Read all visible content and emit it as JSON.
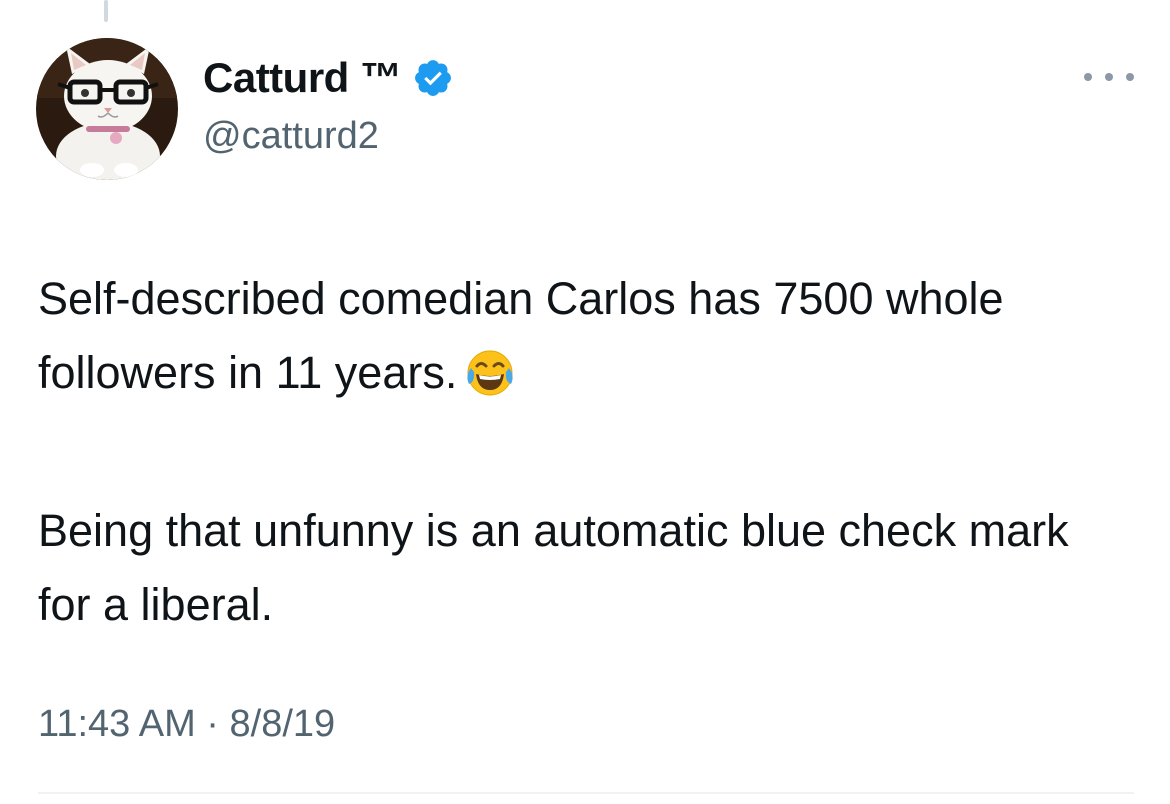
{
  "author": {
    "display_name": "Catturd ™",
    "handle": "@catturd2",
    "verified": true,
    "verified_color": "#1d9bf0"
  },
  "menu": {
    "icon": "more-horizontal-icon"
  },
  "tweet": {
    "paragraphs": [
      "Self-described comedian Carlos has 7500 whole followers in 11 years.",
      "Being that unfunny is an automatic blue check mark for a liberal."
    ],
    "emoji": "face-with-tears-of-joy-icon"
  },
  "meta": {
    "time": "11:43 AM",
    "separator": "·",
    "date": "8/8/19"
  }
}
